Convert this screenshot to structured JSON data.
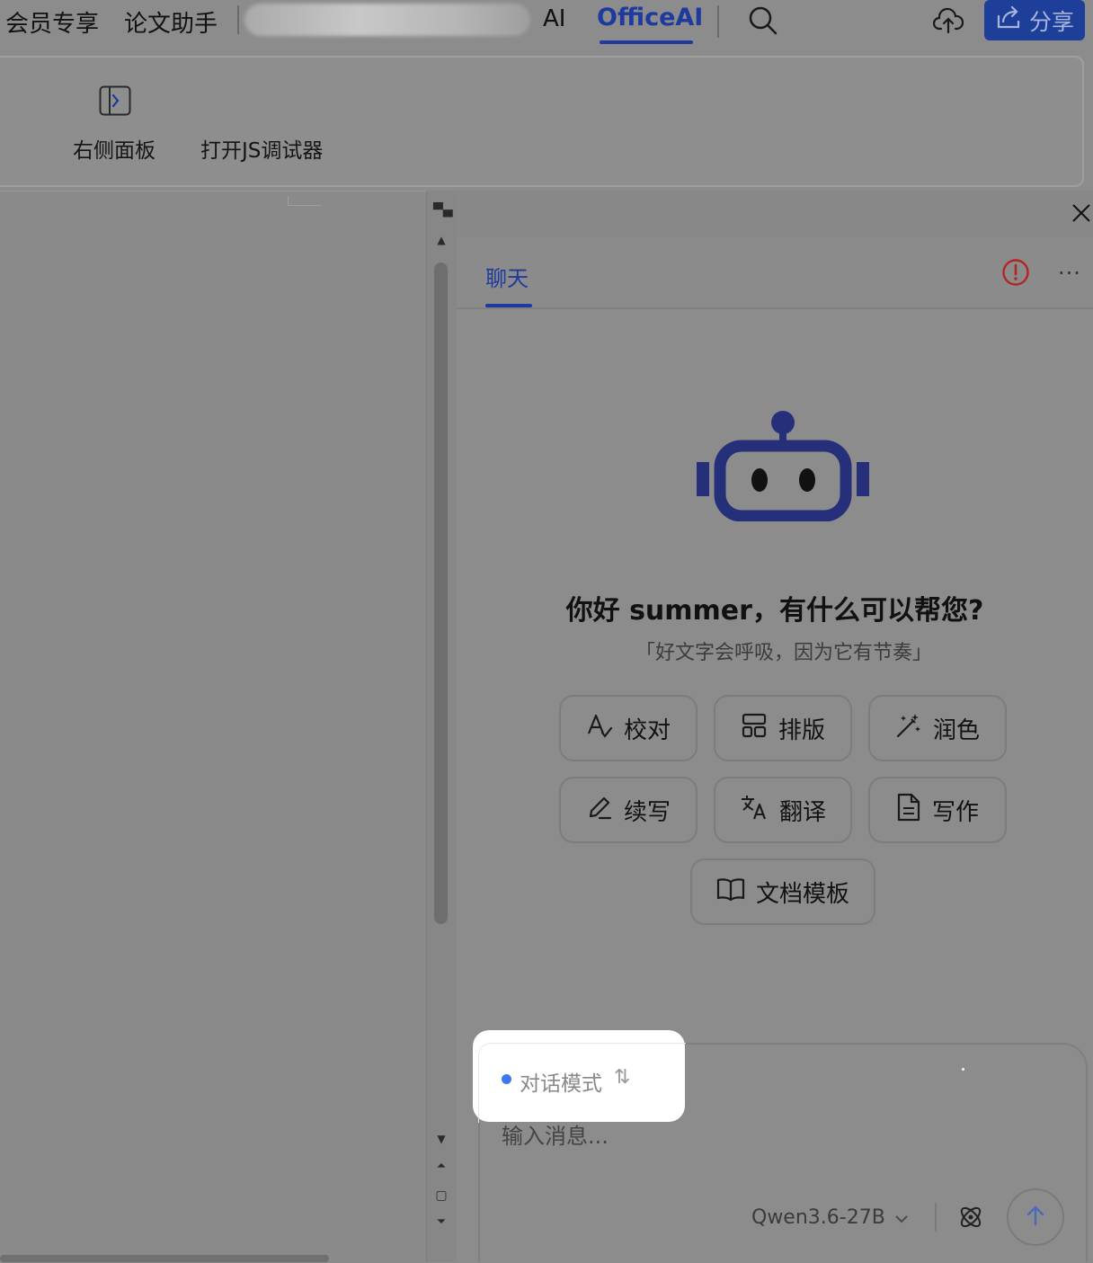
{
  "topbar": {
    "tab_vip": "会员专享",
    "tab_paper": "论文助手",
    "tab_partial": "AI",
    "tab_officeai": "OfficeAI",
    "share_label": "分享"
  },
  "ribbon": {
    "right_panel_label": "右侧面板",
    "js_debugger_label": "打开JS调试器"
  },
  "panel": {
    "chat_tab": "聊天",
    "more": "···",
    "greeting": "你好 summer，有什么可以帮您?",
    "slogan": "「好文字会呼吸，因为它有节奏」",
    "actions": {
      "proofread": "校对",
      "layout": "排版",
      "polish": "润色",
      "continue": "续写",
      "translate": "翻译",
      "write": "写作",
      "templates": "文档模板"
    },
    "input_placeholder": "输入消息...",
    "mode_label": "对话模式",
    "mode_switch": "⇅",
    "model_name": "Qwen3.6-27B"
  },
  "colors": {
    "accent": "#1f3a9e",
    "alert": "#b42424",
    "mode_dot": "#3b78f0",
    "dimmed_background": "#8c8c8c"
  },
  "icons": {
    "search": "search-icon",
    "cloud_upload": "cloud-upload-icon",
    "share": "share-icon",
    "right_panel": "panel-right-icon",
    "close": "close-icon",
    "alert": "alert-circle-icon",
    "robot": "robot-icon",
    "atom": "atom-icon",
    "send": "arrow-up-icon"
  }
}
